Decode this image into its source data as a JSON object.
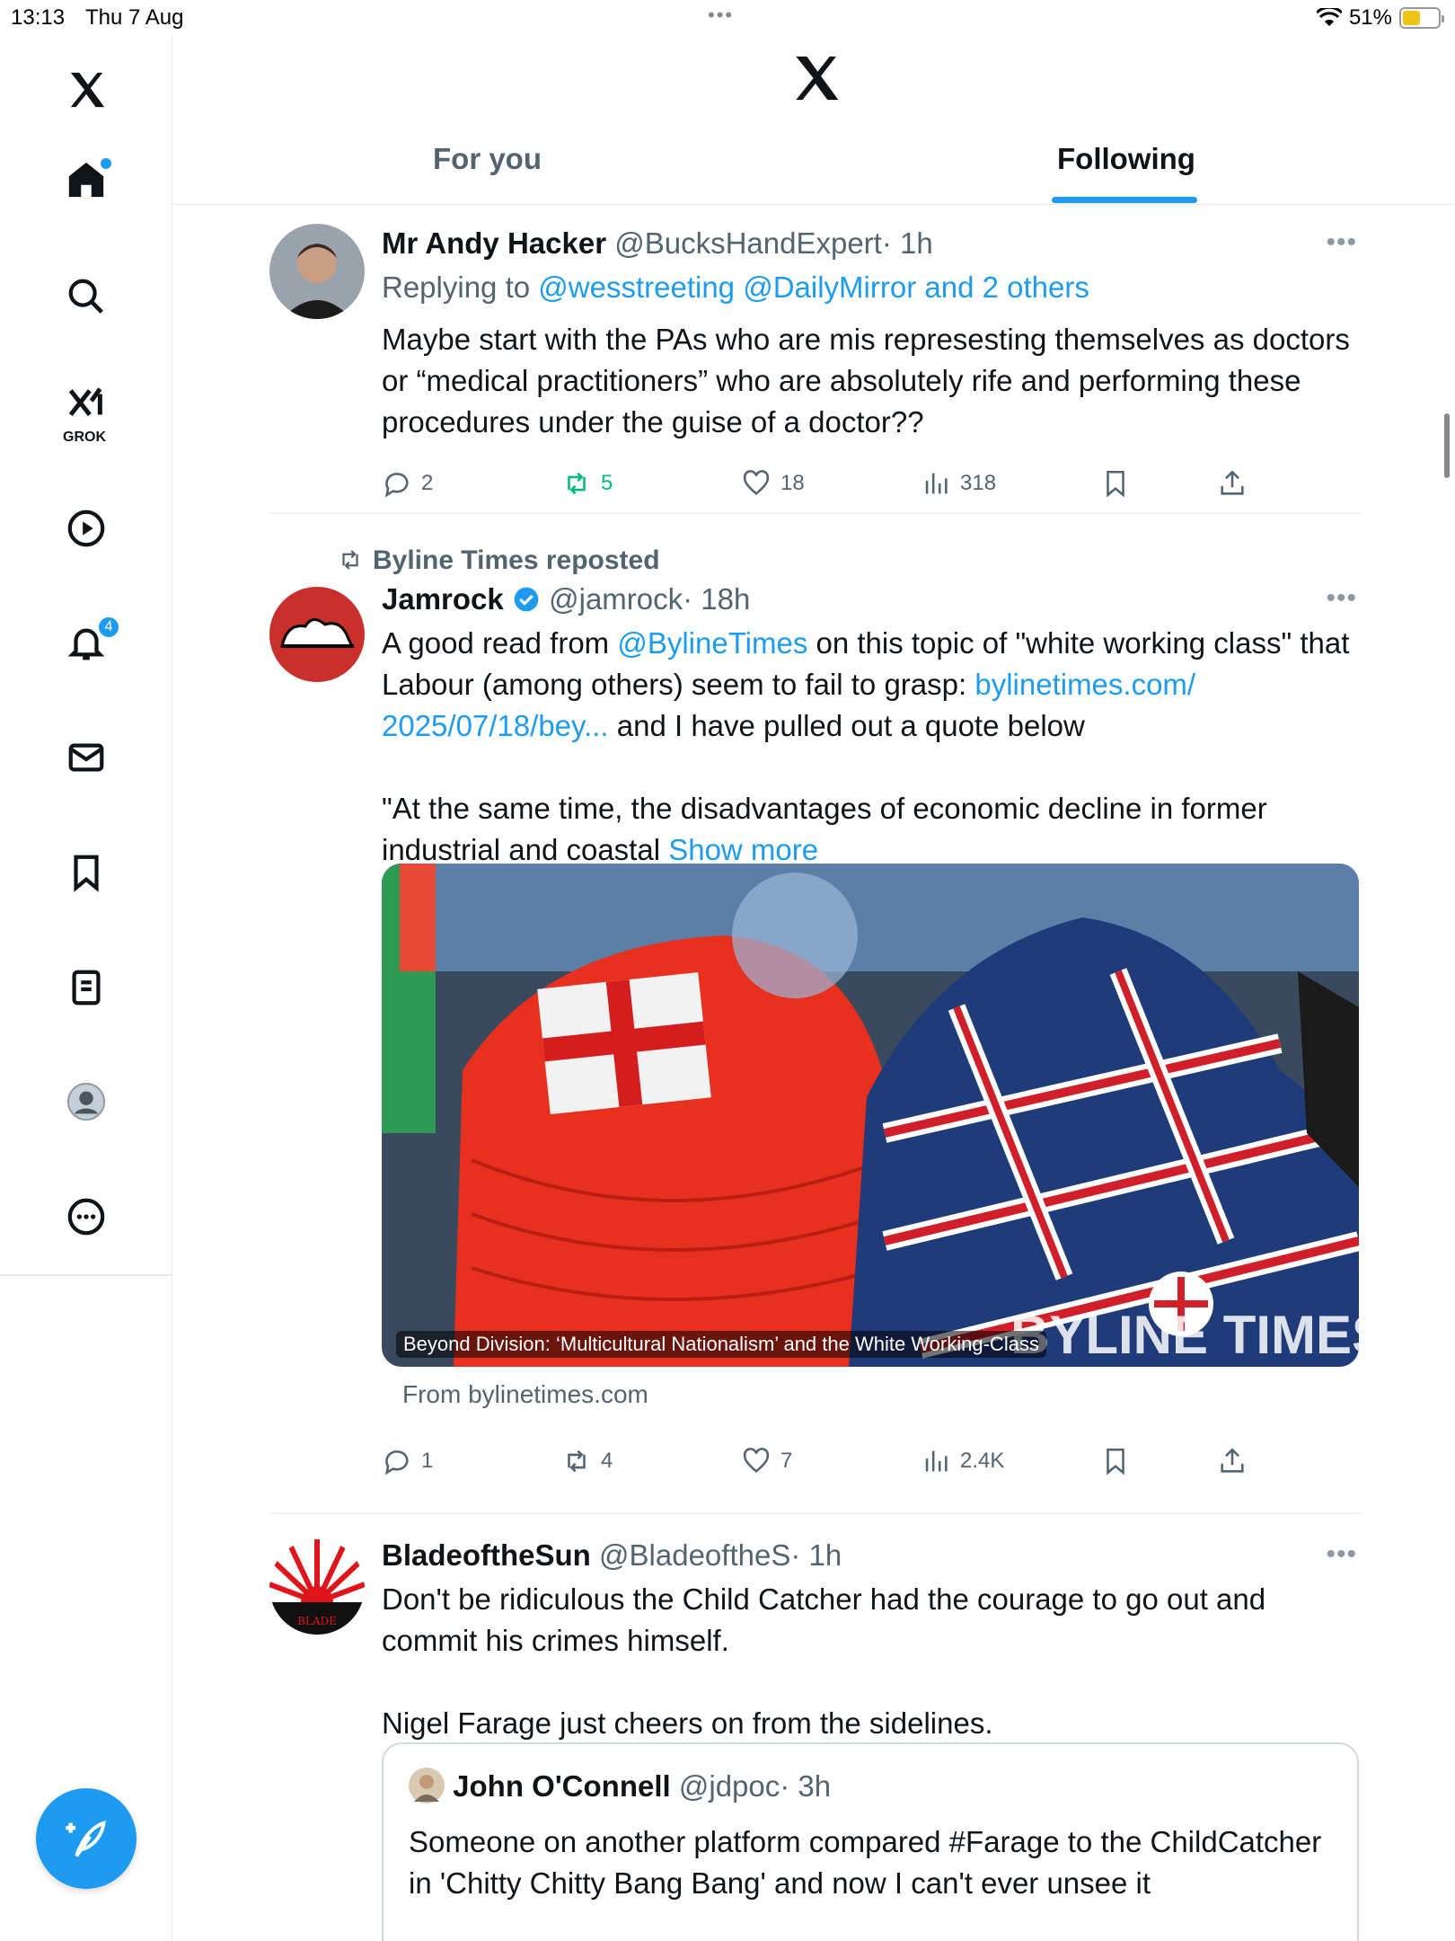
{
  "status": {
    "time": "13:13",
    "date": "Thu 7 Aug",
    "battery": "51%",
    "battery_level": 0.51
  },
  "sidebar": {
    "grok_label": "GROK",
    "notifications_count": "4"
  },
  "header": {
    "tabs": [
      {
        "label": "For you",
        "active": false
      },
      {
        "label": "Following",
        "active": true
      }
    ]
  },
  "posts": [
    {
      "name": "Mr Andy Hacker",
      "handle": "@BucksHandExpert",
      "time": "· 1h",
      "replying_prefix": "Replying to",
      "replying_to": "@wesstreeting @DailyMirror and 2 others",
      "text": "Maybe start with the PAs who are mis represesting themselves as doctors or “medical practitioners” who are absolutely rife and performing these procedures under the guise of a doctor??",
      "replies": "2",
      "reposts": "5",
      "likes": "18",
      "views": "318"
    },
    {
      "reposted_by": "Byline Times reposted",
      "name": "Jamrock",
      "handle": "@jamrock",
      "time": "· 18h",
      "text_a": "A good read from ",
      "mention": "@BylineTimes",
      "text_b": " on this topic of \"white working class\" that Labour (among others) seem to fail to grasp: ",
      "url": "bylinetimes.com/ 2025/07/18/bey...",
      "text_c": " and I have pulled out a quote below",
      "text_d": "\"At the same time, the disadvantages of economic decline in former industrial and coastal ",
      "show_more": "Show more",
      "card_caption": "Beyond Division: ‘Multicultural Nationalism’ and the White Working-Class",
      "card_source": "From bylinetimes.com",
      "replies": "1",
      "reposts": "4",
      "likes": "7",
      "views": "2.4K"
    },
    {
      "name": "BladeoftheSun",
      "handle": "@BladeoftheS",
      "time": "· 1h",
      "text_a": "Don't be ridiculous the Child Catcher had the courage to go out and commit his crimes himself.",
      "text_b": "Nigel Farage just cheers on from the sidelines.",
      "quote": {
        "name": "John O'Connell",
        "handle": "@jdpoc",
        "time": "· 3h",
        "text": "Someone on another platform compared #Farage to the ChildCatcher in 'Chitty Chitty Bang Bang' and now I can't ever unsee it"
      }
    }
  ]
}
